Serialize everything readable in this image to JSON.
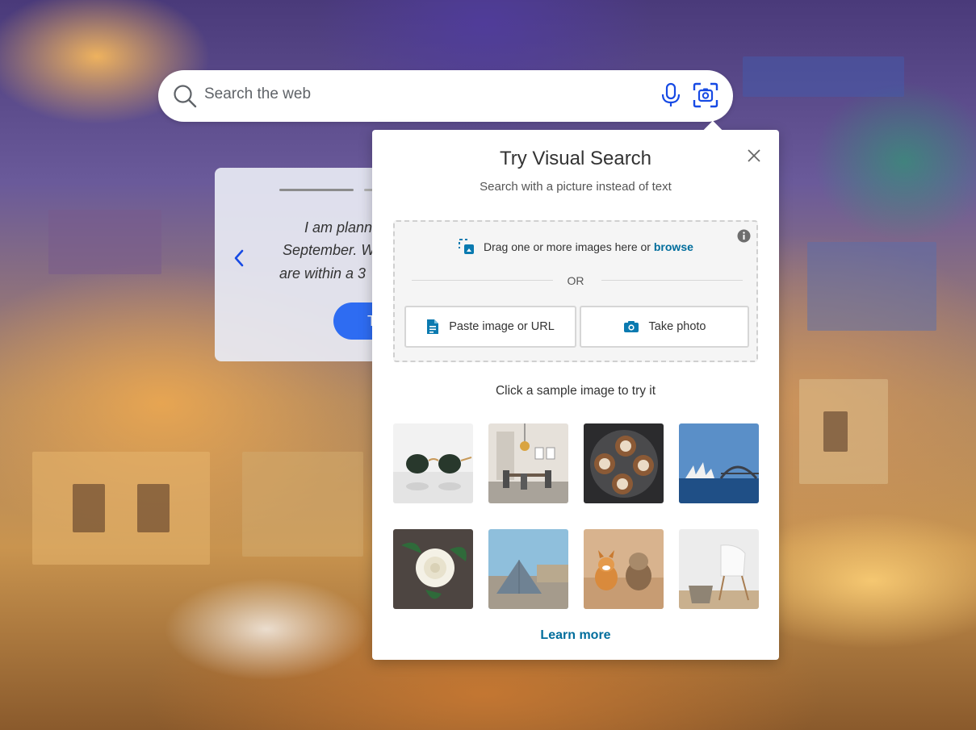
{
  "search": {
    "placeholder": "Search the web",
    "search_icon": "search-icon",
    "mic_icon": "microphone-icon",
    "visual_search_icon": "visual-search-icon"
  },
  "carousel": {
    "prev_icon": "chevron-left-icon",
    "lines": [
      "I am plann",
      "September. W",
      "are within a 3"
    ],
    "button_label": "T"
  },
  "visual_search": {
    "title": "Try Visual Search",
    "subtitle": "Search with a picture instead of text",
    "close_icon": "close-icon",
    "info_icon": "info-icon",
    "drag_text": "Drag one or more images here or",
    "browse_label": "browse",
    "or_label": "OR",
    "paste_label": "Paste image or URL",
    "take_photo_label": "Take photo",
    "sample_label": "Click a sample image to try it",
    "samples": [
      "sunglasses",
      "dining room",
      "latte art",
      "sydney opera house",
      "white rose",
      "louvre pyramid",
      "dogs",
      "white chair"
    ],
    "learn_more_label": "Learn more"
  },
  "colors": {
    "accent_link": "#006d9c",
    "icon_blue": "#174ae4",
    "carousel_button": "#2e6cf2"
  }
}
